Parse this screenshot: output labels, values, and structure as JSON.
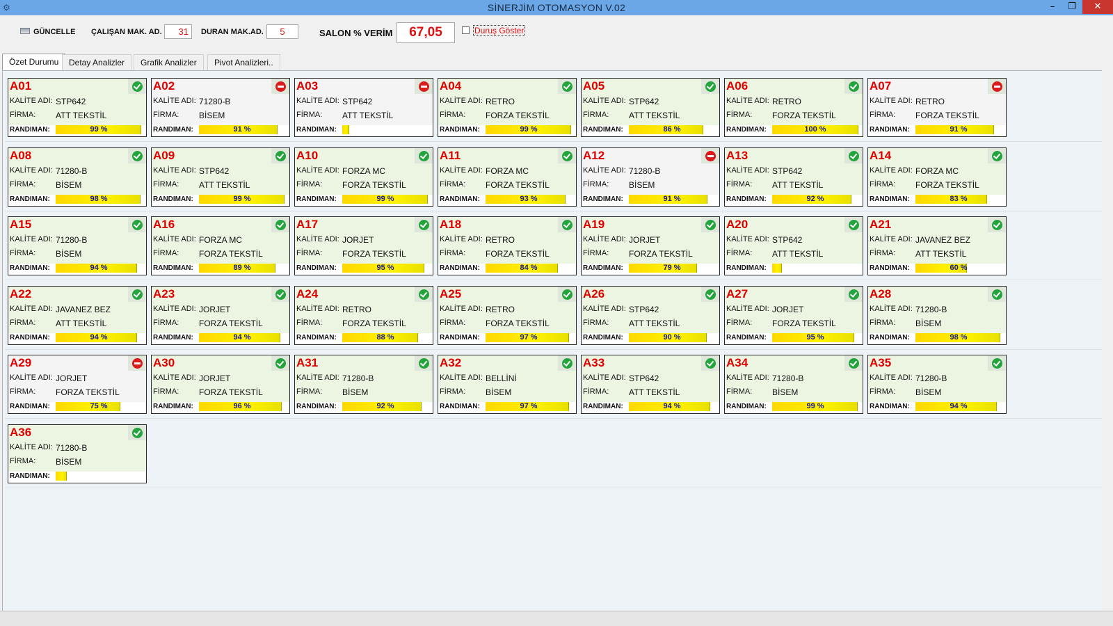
{
  "window": {
    "title": "SİNERJİM OTOMASYON V.02",
    "minimize": "–",
    "maximize": "❐",
    "close": "✕"
  },
  "toolbar": {
    "refresh_label": "GÜNCELLE",
    "running_label": "ÇALIŞAN MAK. AD.",
    "running_value": "31",
    "stopped_label": "DURAN MAK.AD.",
    "stopped_value": "5",
    "efficiency_label": "SALON % VERİM",
    "efficiency_value": "67,05",
    "show_stops_label": "Duruş Göster"
  },
  "tabs": [
    "Özet Durumu",
    "Detay Analizler",
    "Grafik Analizler",
    "Pivot Analizleri.."
  ],
  "labels": {
    "quality": "KALİTE ADI:",
    "company": "FİRMA:",
    "efficiency": "RANDIMAN:"
  },
  "colors": {
    "running_icon": "#23a43c",
    "stopped_icon": "#d91b1b",
    "bar": "#fff200",
    "code": "#e00000"
  },
  "machines": [
    {
      "code": "A01",
      "quality": "STP642",
      "company": "ATT TEKSTİL",
      "efficiency": 99,
      "pct_label": "99 %",
      "status": "running"
    },
    {
      "code": "A02",
      "quality": "71280-B",
      "company": "BİSEM",
      "efficiency": 91,
      "pct_label": "91 %",
      "status": "stopped"
    },
    {
      "code": "A03",
      "quality": "STP642",
      "company": "ATT TEKSTİL",
      "efficiency": 8,
      "pct_label": "",
      "status": "stopped"
    },
    {
      "code": "A04",
      "quality": "RETRO",
      "company": "FORZA TEKSTİL",
      "efficiency": 99,
      "pct_label": "99 %",
      "status": "running"
    },
    {
      "code": "A05",
      "quality": "STP642",
      "company": "ATT TEKSTİL",
      "efficiency": 86,
      "pct_label": "86 %",
      "status": "running"
    },
    {
      "code": "A06",
      "quality": "RETRO",
      "company": "FORZA TEKSTİL",
      "efficiency": 100,
      "pct_label": "100 %",
      "status": "running"
    },
    {
      "code": "A07",
      "quality": "RETRO",
      "company": "FORZA TEKSTİL",
      "efficiency": 91,
      "pct_label": "91 %",
      "status": "stopped"
    },
    {
      "code": "A08",
      "quality": "71280-B",
      "company": "BİSEM",
      "efficiency": 98,
      "pct_label": "98 %",
      "status": "running"
    },
    {
      "code": "A09",
      "quality": "STP642",
      "company": "ATT TEKSTİL",
      "efficiency": 99,
      "pct_label": "99 %",
      "status": "running"
    },
    {
      "code": "A10",
      "quality": "FORZA MC",
      "company": "FORZA TEKSTİL",
      "efficiency": 99,
      "pct_label": "99 %",
      "status": "running"
    },
    {
      "code": "A11",
      "quality": "FORZA MC",
      "company": "FORZA TEKSTİL",
      "efficiency": 93,
      "pct_label": "93 %",
      "status": "running"
    },
    {
      "code": "A12",
      "quality": "71280-B",
      "company": "BİSEM",
      "efficiency": 91,
      "pct_label": "91 %",
      "status": "stopped"
    },
    {
      "code": "A13",
      "quality": "STP642",
      "company": "ATT TEKSTİL",
      "efficiency": 92,
      "pct_label": "92 %",
      "status": "running"
    },
    {
      "code": "A14",
      "quality": "FORZA MC",
      "company": "FORZA TEKSTİL",
      "efficiency": 83,
      "pct_label": "83 %",
      "status": "running"
    },
    {
      "code": "A15",
      "quality": "71280-B",
      "company": "BİSEM",
      "efficiency": 94,
      "pct_label": "94 %",
      "status": "running"
    },
    {
      "code": "A16",
      "quality": "FORZA MC",
      "company": "FORZA TEKSTİL",
      "efficiency": 89,
      "pct_label": "89 %",
      "status": "running"
    },
    {
      "code": "A17",
      "quality": "JORJET",
      "company": "FORZA TEKSTİL",
      "efficiency": 95,
      "pct_label": "95 %",
      "status": "running"
    },
    {
      "code": "A18",
      "quality": "RETRO",
      "company": "FORZA TEKSTİL",
      "efficiency": 84,
      "pct_label": "84 %",
      "status": "running"
    },
    {
      "code": "A19",
      "quality": "JORJET",
      "company": "FORZA TEKSTİL",
      "efficiency": 79,
      "pct_label": "79 %",
      "status": "running"
    },
    {
      "code": "A20",
      "quality": "STP642",
      "company": "ATT TEKSTİL",
      "efficiency": 11,
      "pct_label": "",
      "status": "running"
    },
    {
      "code": "A21",
      "quality": "JAVANEZ BEZ",
      "company": "ATT TEKSTİL",
      "efficiency": 60,
      "pct_label": "60 %",
      "status": "running"
    },
    {
      "code": "A22",
      "quality": "JAVANEZ BEZ",
      "company": "ATT TEKSTİL",
      "efficiency": 94,
      "pct_label": "94 %",
      "status": "running"
    },
    {
      "code": "A23",
      "quality": "JORJET",
      "company": "FORZA TEKSTİL",
      "efficiency": 94,
      "pct_label": "94 %",
      "status": "running"
    },
    {
      "code": "A24",
      "quality": "RETRO",
      "company": "FORZA TEKSTİL",
      "efficiency": 88,
      "pct_label": "88 %",
      "status": "running"
    },
    {
      "code": "A25",
      "quality": "RETRO",
      "company": "FORZA TEKSTİL",
      "efficiency": 97,
      "pct_label": "97 %",
      "status": "running"
    },
    {
      "code": "A26",
      "quality": "STP642",
      "company": "ATT TEKSTİL",
      "efficiency": 90,
      "pct_label": "90 %",
      "status": "running"
    },
    {
      "code": "A27",
      "quality": "JORJET",
      "company": "FORZA TEKSTİL",
      "efficiency": 95,
      "pct_label": "95 %",
      "status": "running"
    },
    {
      "code": "A28",
      "quality": "71280-B",
      "company": "BİSEM",
      "efficiency": 98,
      "pct_label": "98 %",
      "status": "running"
    },
    {
      "code": "A29",
      "quality": "JORJET",
      "company": "FORZA TEKSTİL",
      "efficiency": 75,
      "pct_label": "75 %",
      "status": "stopped"
    },
    {
      "code": "A30",
      "quality": "JORJET",
      "company": "FORZA TEKSTİL",
      "efficiency": 96,
      "pct_label": "96 %",
      "status": "running"
    },
    {
      "code": "A31",
      "quality": "71280-B",
      "company": "BİSEM",
      "efficiency": 92,
      "pct_label": "92 %",
      "status": "running"
    },
    {
      "code": "A32",
      "quality": "BELLİNİ",
      "company": "BİSEM",
      "efficiency": 97,
      "pct_label": "97 %",
      "status": "running"
    },
    {
      "code": "A33",
      "quality": "STP642",
      "company": "ATT TEKSTİL",
      "efficiency": 94,
      "pct_label": "94 %",
      "status": "running"
    },
    {
      "code": "A34",
      "quality": "71280-B",
      "company": "BİSEM",
      "efficiency": 99,
      "pct_label": "99 %",
      "status": "running"
    },
    {
      "code": "A35",
      "quality": "71280-B",
      "company": "BİSEM",
      "efficiency": 94,
      "pct_label": "94 %",
      "status": "running"
    },
    {
      "code": "A36",
      "quality": "71280-B",
      "company": "BİSEM",
      "efficiency": 13,
      "pct_label": "",
      "status": "running"
    }
  ]
}
